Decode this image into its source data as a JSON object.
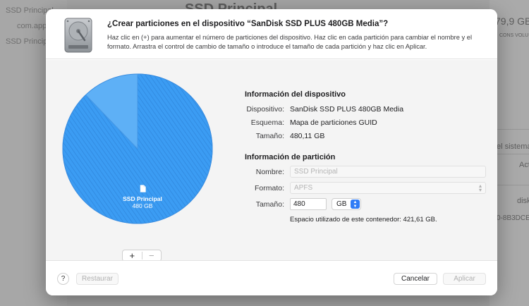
{
  "background": {
    "sidebar_items": [
      "SSD Principal",
      "com.apple",
      "SSD Principal"
    ],
    "title": "SSD Principal",
    "right_texts": [
      "79,9 GB",
      "CONS VOLU",
      "el sistema",
      "Act",
      "disk",
      "0-8B3DCE"
    ]
  },
  "dialog": {
    "title": "¿Crear particiones en el dispositivo “SanDisk SSD PLUS 480GB Media”?",
    "description": "Haz clic en (+) para aumentar el número de particiones del dispositivo. Haz clic en cada partición para cambiar el nombre y el formato. Arrastra el control de cambio de tamaño o introduce el tamaño de cada partición y haz clic en Aplicar.",
    "icon": "hard-drive-icon"
  },
  "pie": {
    "partition_name": "SSD Principal",
    "partition_size": "480 GB",
    "used_fraction": 0.878,
    "color": "#3b9cf3",
    "add_label": "+",
    "remove_label": "−"
  },
  "device_info": {
    "heading": "Información del dispositivo",
    "rows": [
      {
        "label": "Dispositivo:",
        "value": "SanDisk SSD PLUS 480GB Media"
      },
      {
        "label": "Esquema:",
        "value": "Mapa de particiones GUID"
      },
      {
        "label": "Tamaño:",
        "value": "480,11 GB"
      }
    ]
  },
  "partition_info": {
    "heading": "Información de partición",
    "name_label": "Nombre:",
    "name_placeholder": "SSD Principal",
    "format_label": "Formato:",
    "format_value": "APFS",
    "size_label": "Tamaño:",
    "size_value": "480",
    "unit_value": "GB",
    "note": "Espacio utilizado de este contenedor: 421,61 GB."
  },
  "footer": {
    "help_label": "?",
    "restore_label": "Restaurar",
    "cancel_label": "Cancelar",
    "apply_label": "Aplicar"
  }
}
